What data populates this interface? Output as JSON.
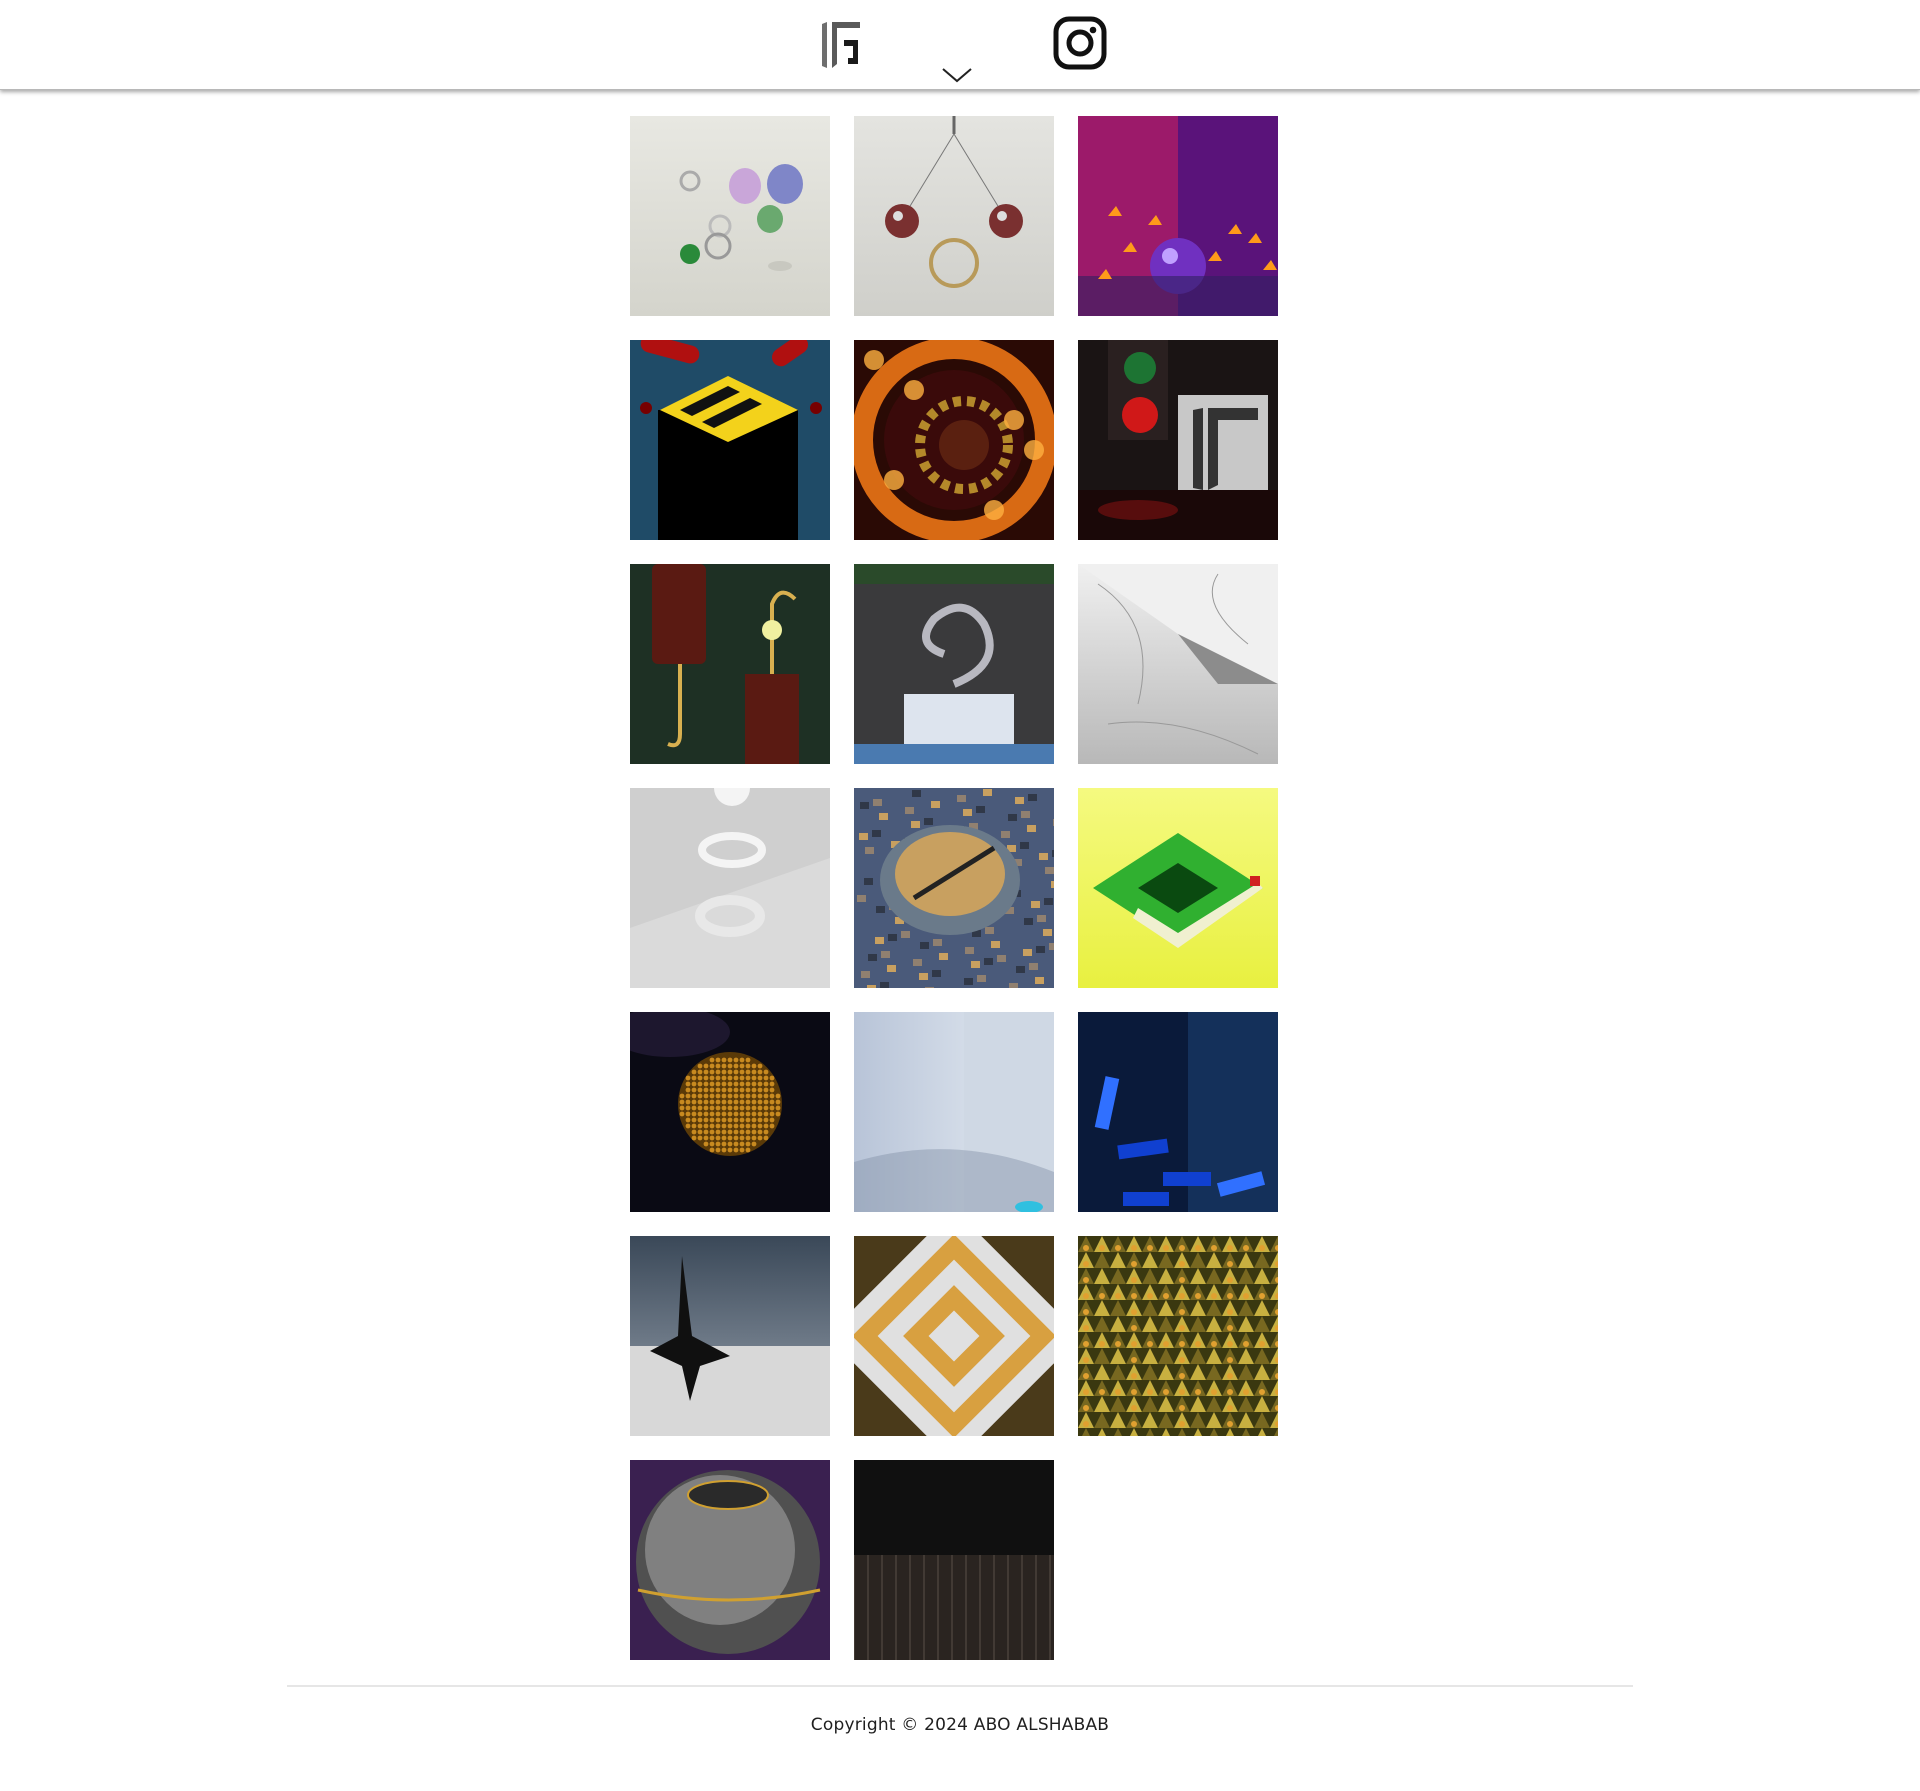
{
  "header": {
    "logo_icon": "kg-monogram-logo",
    "menu_icon": "chevron-down-icon",
    "social_icon": "instagram-icon"
  },
  "gallery": {
    "items": [
      {
        "scene": "glass-rings-cylinders",
        "colors": [
          "#e8e8e2",
          "#c9a6d9",
          "#7f86c8",
          "#6aa96f"
        ]
      },
      {
        "scene": "pendulum-spheres-ring",
        "colors": [
          "#e4e4e0",
          "#7a3030",
          "#b89a5a"
        ]
      },
      {
        "scene": "purple-sphere-fire",
        "colors": [
          "#9c1a6a",
          "#5a137a",
          "#ff9a1a",
          "#7030c0"
        ]
      },
      {
        "scene": "hazard-box-red-tubes",
        "colors": [
          "#1f4b67",
          "#000000",
          "#f3d21b",
          "#b01010"
        ]
      },
      {
        "scene": "fire-gear-ring",
        "colors": [
          "#2a0a05",
          "#d86a14",
          "#b4892a",
          "#ffb040"
        ]
      },
      {
        "scene": "traffic-light-logo-room",
        "colors": [
          "#1a1414",
          "#d01818",
          "#1a8a38",
          "#555555"
        ]
      },
      {
        "scene": "copper-hook-cylinders",
        "colors": [
          "#1e3024",
          "#5a1a12",
          "#d8b050",
          "#f0f0a0"
        ]
      },
      {
        "scene": "marble-spiral-sculpture",
        "colors": [
          "#2c2c2c",
          "#b8b8c0",
          "#4a7ab0",
          "#2a4a2a"
        ]
      },
      {
        "scene": "white-marble-pyramid",
        "colors": [
          "#b8b8b8",
          "#f0f0f0",
          "#8c8c8c"
        ]
      },
      {
        "scene": "white-torus-rings",
        "colors": [
          "#cfcfcf",
          "#f4f4f4",
          "#a8a8a8"
        ]
      },
      {
        "scene": "coin-pit-camouflage",
        "colors": [
          "#4a5a7a",
          "#c8a060",
          "#303848",
          "#908070"
        ]
      },
      {
        "scene": "green-block-path",
        "colors": [
          "#e8f040",
          "#30b030",
          "#f0f0d0",
          "#d02020"
        ]
      },
      {
        "scene": "golden-bead-sphere",
        "colors": [
          "#0a0a14",
          "#c88a20",
          "#2a2040"
        ]
      },
      {
        "scene": "white-room-corner",
        "colors": [
          "#b8c4d8",
          "#e8eef4",
          "#7a8aa0",
          "#30c0e0"
        ]
      },
      {
        "scene": "blue-neon-blocks",
        "colors": [
          "#0a1a3a",
          "#1040d0",
          "#3070ff",
          "#14305a"
        ]
      },
      {
        "scene": "black-spinning-top",
        "colors": [
          "#3a4858",
          "#d8d8d8",
          "#101010"
        ]
      },
      {
        "scene": "golden-square-steps",
        "colors": [
          "#4a3a1a",
          "#d8a040",
          "#e0e0e0",
          "#8a7040"
        ]
      },
      {
        "scene": "gold-triangle-field",
        "colors": [
          "#3a3810",
          "#c8b040",
          "#786820",
          "#e0a030"
        ]
      },
      {
        "scene": "metal-sphere-purple",
        "colors": [
          "#3a2050",
          "#a0a0a0",
          "#505050",
          "#d0a030"
        ]
      },
      {
        "scene": "dark-wood-wall",
        "colors": [
          "#101010",
          "#2a2420",
          "#5a5048"
        ]
      }
    ]
  },
  "footer": {
    "copyright": "Copyright © 2024 ABO ALSHABAB"
  }
}
